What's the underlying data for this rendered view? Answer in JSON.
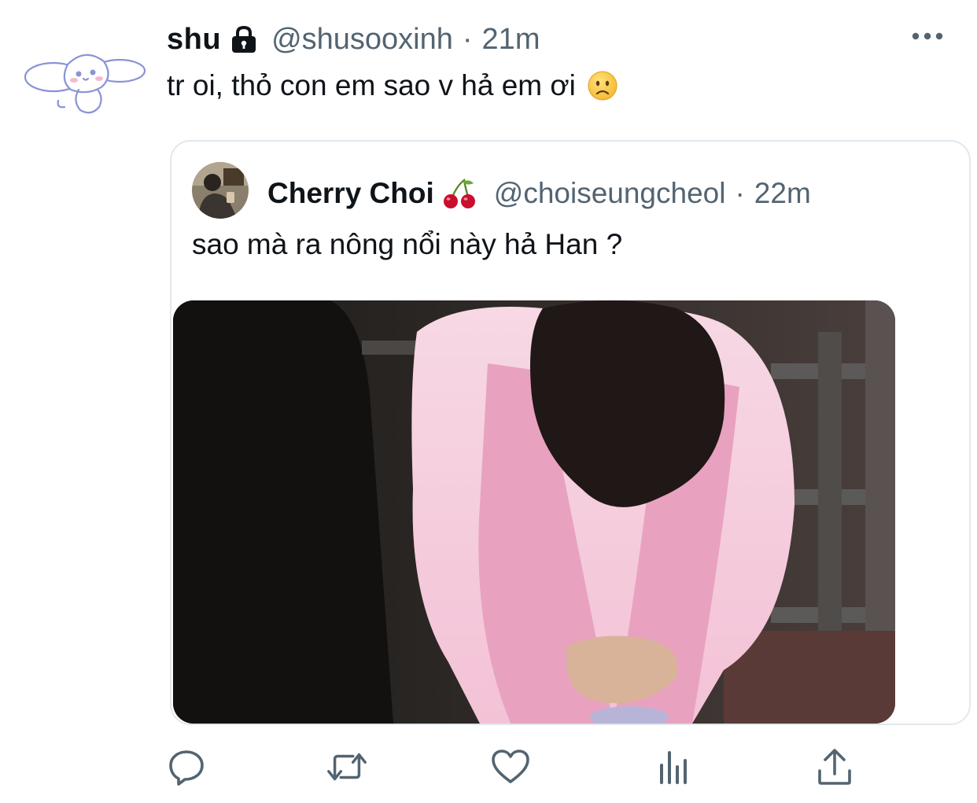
{
  "tweet": {
    "display_name": "shu",
    "lock_icon": "lock-icon",
    "handle": "@shusooxinh",
    "separator": "·",
    "time": "21m",
    "text": "tr oi, thỏ con em sao v hả em ơi",
    "emoji": "worried-face-emoji",
    "avatar": "cinnamoroll-avatar"
  },
  "quoted": {
    "display_name": "Cherry Choi",
    "name_emoji": "cherries-emoji",
    "handle": "@choiseungcheol",
    "separator": "·",
    "time": "22m",
    "text": "sao mà ra nông nổi này hả Han ?",
    "media": "photo of person in pink sweater bowing head"
  },
  "actions": [
    "reply-icon",
    "retweet-icon",
    "like-icon",
    "analytics-icon",
    "share-icon"
  ],
  "colors": {
    "primary_text": "#0f1419",
    "secondary_text": "#536471",
    "border": "#e1e8ed",
    "icon_gray": "#536471"
  }
}
